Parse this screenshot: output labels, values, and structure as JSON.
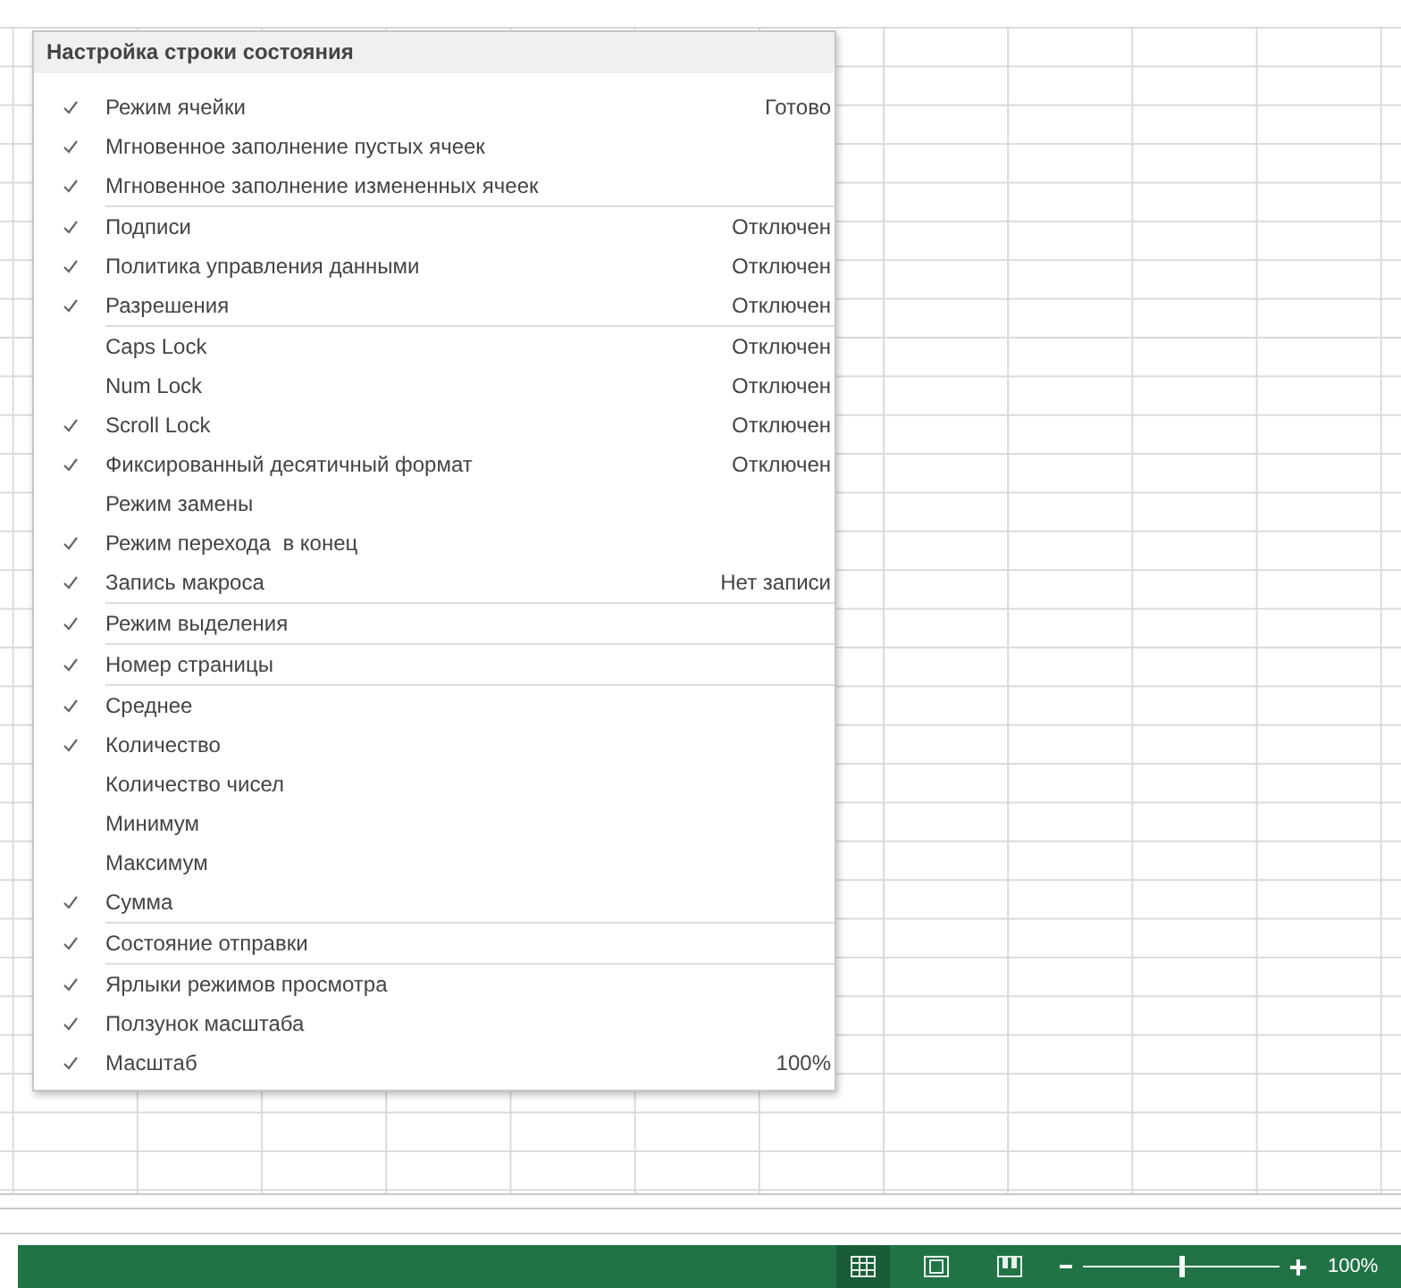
{
  "menu": {
    "title": "Настройка строки состояния",
    "items": [
      {
        "label": "Режим ячейки",
        "value": "Готово",
        "checked": true,
        "separator_before": false
      },
      {
        "label": "Мгновенное заполнение пустых ячеек",
        "checked": true,
        "separator_before": false
      },
      {
        "label": "Мгновенное заполнение измененных ячеек",
        "checked": true,
        "separator_before": false
      },
      {
        "label": "Подписи",
        "value": "Отключен",
        "checked": true,
        "separator_before": true
      },
      {
        "label": "Политика управления данными",
        "value": "Отключен",
        "checked": true,
        "separator_before": false
      },
      {
        "label": "Разрешения",
        "value": "Отключен",
        "checked": true,
        "separator_before": false
      },
      {
        "label": "Caps Lock",
        "value": "Отключен",
        "checked": false,
        "separator_before": true
      },
      {
        "label": "Num Lock",
        "value": "Отключен",
        "checked": false,
        "separator_before": false
      },
      {
        "label": "Scroll Lock",
        "value": "Отключен",
        "checked": true,
        "separator_before": false
      },
      {
        "label": "Фиксированный десятичный формат",
        "value": "Отключен",
        "checked": true,
        "separator_before": false
      },
      {
        "label": "Режим замены",
        "checked": false,
        "separator_before": false
      },
      {
        "label": "Режим перехода  в конец",
        "checked": true,
        "separator_before": false
      },
      {
        "label": "Запись макроса",
        "value": "Нет записи",
        "checked": true,
        "separator_before": false
      },
      {
        "label": "Режим выделения",
        "checked": true,
        "separator_before": true
      },
      {
        "label": "Номер страницы",
        "checked": true,
        "separator_before": true
      },
      {
        "label": "Среднее",
        "checked": true,
        "separator_before": true
      },
      {
        "label": "Количество",
        "checked": true,
        "separator_before": false
      },
      {
        "label": "Количество чисел",
        "checked": false,
        "separator_before": false
      },
      {
        "label": "Минимум",
        "checked": false,
        "separator_before": false
      },
      {
        "label": "Максимум",
        "checked": false,
        "separator_before": false
      },
      {
        "label": "Сумма",
        "checked": true,
        "separator_before": false
      },
      {
        "label": "Состояние отправки",
        "checked": true,
        "separator_before": true
      },
      {
        "label": "Ярлыки режимов просмотра",
        "checked": true,
        "separator_before": true
      },
      {
        "label": "Ползунок масштаба",
        "checked": true,
        "separator_before": false
      },
      {
        "label": "Масштаб",
        "value": "100%",
        "checked": true,
        "separator_before": false
      }
    ]
  },
  "status_bar": {
    "view_buttons": [
      {
        "kind": "normal",
        "selected": true
      },
      {
        "kind": "layout",
        "selected": false
      },
      {
        "kind": "pagebreak",
        "selected": false
      }
    ],
    "zoom_slider": {
      "level": 0.5
    },
    "zoom_text": "100%"
  }
}
